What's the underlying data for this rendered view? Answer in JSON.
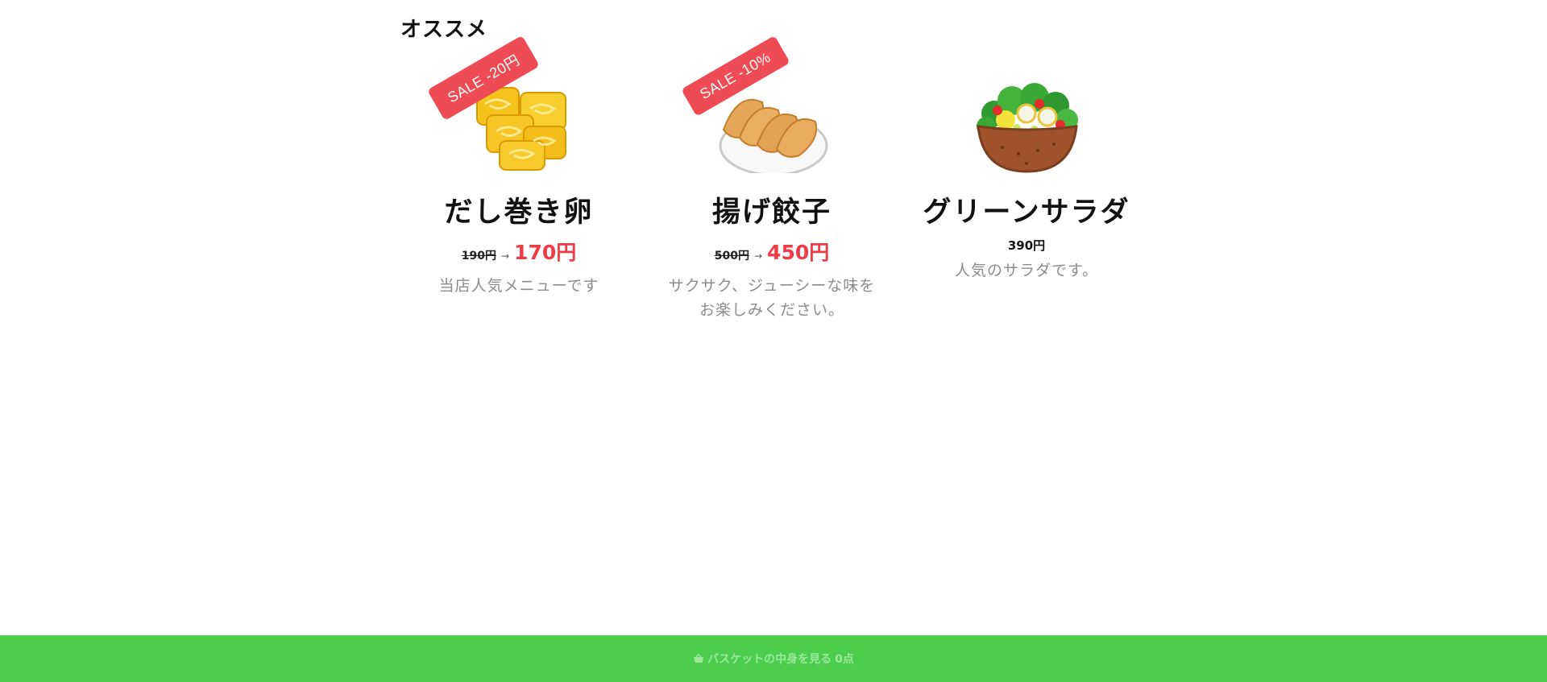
{
  "section": {
    "title": "オススメ"
  },
  "products": [
    {
      "name": "だし巻き卵",
      "sale_badge": "SALE -20円",
      "old_price": "190円",
      "arrow": "→",
      "new_price": "170円",
      "description": "当店人気メニューです",
      "image_icon": "tamagoyaki-image"
    },
    {
      "name": "揚げ餃子",
      "sale_badge": "SALE -10%",
      "old_price": "500円",
      "arrow": "→",
      "new_price": "450円",
      "description_line1": "サクサク、ジューシーな味を",
      "description_line2": "お楽しみください。",
      "image_icon": "fried-gyoza-image"
    },
    {
      "name": "グリーンサラダ",
      "price": "390円",
      "description": "人気のサラダです。",
      "image_icon": "green-salad-image"
    }
  ],
  "basket": {
    "label": "バスケットの中身を見る",
    "count": "0点",
    "icon": "basket-icon"
  },
  "colors": {
    "sale_badge": "#ef4b55",
    "sale_price": "#ef3b46",
    "basket_bar": "#4cce4c",
    "description": "#8c8c8c"
  }
}
